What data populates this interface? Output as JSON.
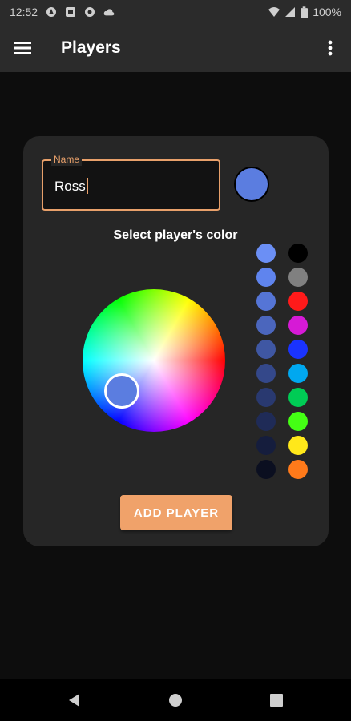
{
  "status_bar": {
    "time": "12:52",
    "battery": "100%"
  },
  "app_bar": {
    "title": "Players"
  },
  "form": {
    "name_label": "Name",
    "name_value": "Ross",
    "selected_color": "#5b7de0",
    "select_color_title": "Select player's color",
    "add_button_label": "ADD PLAYER"
  },
  "palette": {
    "left_column": [
      "#6b8ff5",
      "#5f84ee",
      "#5575d6",
      "#4b66bd",
      "#3f57a3",
      "#34488a",
      "#293970",
      "#1f2b57",
      "#151d3d",
      "#0b0f20"
    ],
    "right_column": [
      "#000000",
      "#808080",
      "#ff1a1a",
      "#d61ad6",
      "#1a33ff",
      "#00a8f0",
      "#00cc55",
      "#44ff14",
      "#ffe81a",
      "#ff7a1a"
    ]
  },
  "colors": {
    "accent": "#e8a06a",
    "button": "#f0a26a",
    "card": "#262626",
    "appbar": "#2b2b2b"
  }
}
